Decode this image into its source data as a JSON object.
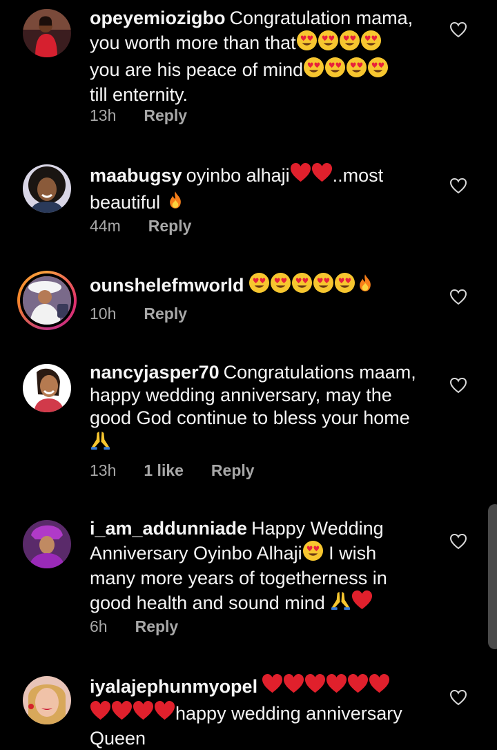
{
  "comments": [
    {
      "username": "opeyemiozigbo",
      "text_lines": [
        "Congratulation mama,",
        "you worth more than that",
        "you are his peace of mind",
        "till enternity."
      ],
      "time": "13h",
      "likes": "",
      "reply_label": "Reply",
      "avatar": "avatar-woman-red-dress",
      "story_ring": false
    },
    {
      "username": "maabugsy",
      "text_lines": [
        "oyinbo alhaji",
        "..most",
        "beautiful"
      ],
      "time": "44m",
      "likes": "",
      "reply_label": "Reply",
      "avatar": "avatar-woman-curly-hair",
      "story_ring": false
    },
    {
      "username": "ounshelefmworld",
      "text_lines": [],
      "time": "10h",
      "likes": "",
      "reply_label": "Reply",
      "avatar": "avatar-woman-white-hat",
      "story_ring": true
    },
    {
      "username": "nancyjasper70",
      "text_lines": [
        "Congratulations maam,",
        "happy wedding anniversary, may the",
        "good God continue to bless your home"
      ],
      "time": "13h",
      "likes": "1 like",
      "reply_label": "Reply",
      "avatar": "avatar-woman-smiling",
      "story_ring": false
    },
    {
      "username": "i_am_addunniade",
      "text_lines": [
        "Happy Wedding",
        "Anniversary Oyinbo Alhaji",
        "I wish",
        "many more years of togetherness in",
        "good health and sound mind"
      ],
      "time": "6h",
      "likes": "",
      "reply_label": "Reply",
      "avatar": "avatar-woman-purple-gele",
      "story_ring": false
    },
    {
      "username": "iyalajephunmyopel",
      "text_lines": [
        "happy wedding anniversary",
        "Queen"
      ],
      "time": "",
      "likes": "",
      "reply_label": "",
      "avatar": "avatar-woman-red-lips",
      "story_ring": false
    }
  ],
  "icons": {
    "like": "heart-outline-icon",
    "heart_eyes": "heart-eyes-emoji",
    "red_heart": "red-heart-emoji",
    "fire": "fire-emoji",
    "praying_hands": "folded-hands-emoji"
  },
  "colors": {
    "background": "#000000",
    "text": "#f5f5f5",
    "meta": "#a8a8a8",
    "heart_red": "#e0202c",
    "emoji_yellow": "#f7c62f"
  }
}
